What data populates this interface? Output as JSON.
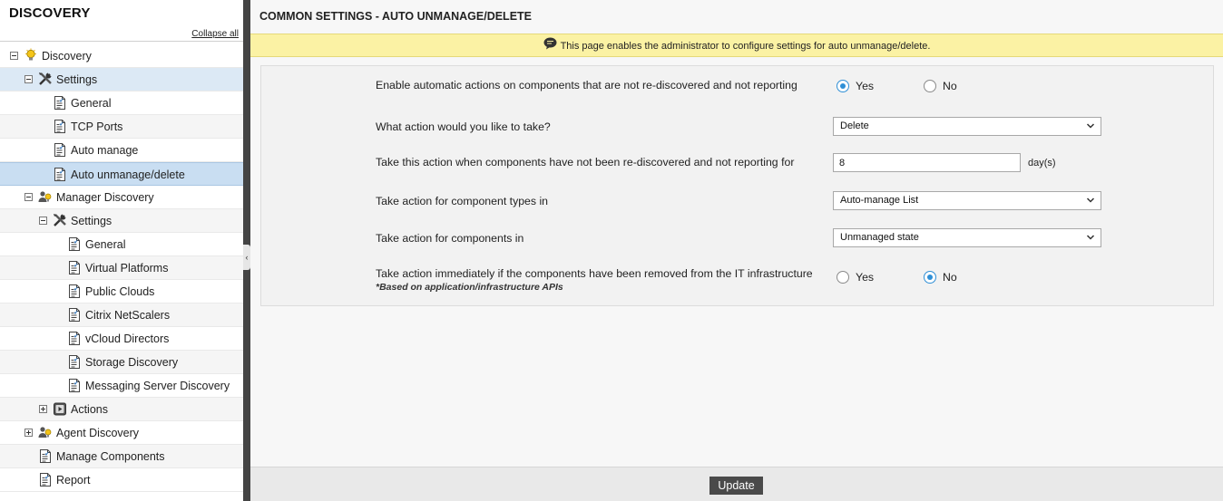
{
  "sidebar": {
    "title": "DISCOVERY",
    "collapse_all": "Collapse all",
    "items": [
      {
        "label": "Discovery"
      },
      {
        "label": "Settings"
      },
      {
        "label": "General"
      },
      {
        "label": "TCP Ports"
      },
      {
        "label": "Auto manage"
      },
      {
        "label": "Auto unmanage/delete"
      },
      {
        "label": "Manager Discovery"
      },
      {
        "label": "Settings"
      },
      {
        "label": "General"
      },
      {
        "label": "Virtual Platforms"
      },
      {
        "label": "Public Clouds"
      },
      {
        "label": "Citrix NetScalers"
      },
      {
        "label": "vCloud Directors"
      },
      {
        "label": "Storage Discovery"
      },
      {
        "label": "Messaging Server Discovery"
      },
      {
        "label": "Actions"
      },
      {
        "label": "Agent Discovery"
      },
      {
        "label": "Manage Components"
      },
      {
        "label": "Report"
      }
    ]
  },
  "main": {
    "title": "COMMON SETTINGS - AUTO UNMANAGE/DELETE",
    "info": "This page enables the administrator to configure settings for auto unmanage/delete.",
    "form": {
      "q1": {
        "label": "Enable automatic actions on components that are not re-discovered and not reporting",
        "yes": "Yes",
        "no": "No",
        "selected": "Yes"
      },
      "q2": {
        "label": "What action would you like to take?",
        "value": "Delete"
      },
      "q3": {
        "label": "Take this action when components have not been re-discovered and not reporting for",
        "value": "8",
        "unit": "day(s)"
      },
      "q4": {
        "label": "Take action for component types in",
        "value": "Auto-manage List"
      },
      "q5": {
        "label": "Take action for components in",
        "value": "Unmanaged state"
      },
      "q6": {
        "label": "Take action immediately if the components have been removed from the IT infrastructure",
        "note": "*Based on application/infrastructure APIs",
        "yes": "Yes",
        "no": "No",
        "selected": "No"
      }
    },
    "update_label": "Update"
  },
  "colors": {
    "banner_bg": "#fbf2a4",
    "radio_accent": "#2f8fd6",
    "selected_row": "#c9def2",
    "splitter": "#444444"
  }
}
